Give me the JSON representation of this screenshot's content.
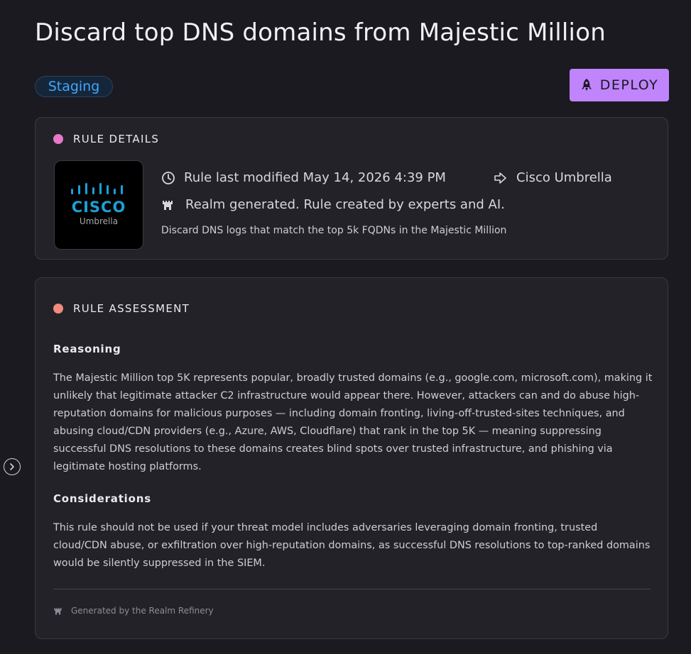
{
  "page": {
    "title": "Discard top DNS domains from Majestic Million"
  },
  "status_badge": {
    "label": "Staging"
  },
  "deploy_button": {
    "label": "DEPLOY"
  },
  "rule_details": {
    "heading": "RULE DETAILS",
    "dot_color": "#e879c9",
    "logo": {
      "brand": "CISCO",
      "product": "Umbrella"
    },
    "modified": "Rule last modified May 14, 2026 4:39 PM",
    "source": "Cisco Umbrella",
    "origin": "Realm generated. Rule created by experts and AI.",
    "description": "Discard DNS logs that match the top 5k FQDNs in the Majestic Million"
  },
  "rule_assessment": {
    "heading": "RULE ASSESSMENT",
    "dot_color": "#f28b7d",
    "reasoning_heading": "Reasoning",
    "reasoning": "The Majestic Million top 5K represents popular, broadly trusted domains (e.g., google.com, microsoft.com), making it unlikely that legitimate attacker C2 infrastructure would appear there. However, attackers can and do abuse high-reputation domains for malicious purposes — including domain fronting, living-off-trusted-sites techniques, and abusing cloud/CDN providers (e.g., Azure, AWS, Cloudflare) that rank in the top 5K — meaning suppressing successful DNS resolutions to these domains creates blind spots over trusted infrastructure, and phishing via legitimate hosting platforms.",
    "considerations_heading": "Considerations",
    "considerations": "This rule should not be used if your threat model includes adversaries leveraging domain fronting, trusted cloud/CDN abuse, or exfiltration over high-reputation domains, as successful DNS resolutions to top-ranked domains would be silently suppressed in the SIEM.",
    "footer": "Generated by the Realm Refinery"
  },
  "colors": {
    "accent": "#c084fc",
    "badge_text": "#3fa7ff",
    "background": "#1b1a20",
    "card": "#232228"
  },
  "icons": [
    "rocket-icon",
    "clock-icon",
    "arrow-right-icon",
    "castle-icon",
    "chevron-right-icon"
  ]
}
